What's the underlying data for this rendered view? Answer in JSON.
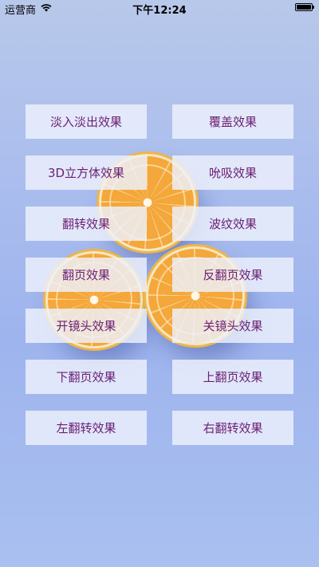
{
  "status_bar": {
    "carrier": "运营商",
    "wifi_icon": "wifi-icon",
    "time": "下午12:24",
    "battery_icon": "battery-icon",
    "battery_level": 1.0
  },
  "colors": {
    "button_text": "#6b1f73",
    "button_bg": "#eef2fc",
    "background": "#a9bcee"
  },
  "effects": [
    {
      "label": "淡入淡出效果"
    },
    {
      "label": "覆盖效果"
    },
    {
      "label": "3D立方体效果"
    },
    {
      "label": "吮吸效果"
    },
    {
      "label": "翻转效果"
    },
    {
      "label": "波纹效果"
    },
    {
      "label": "翻页效果"
    },
    {
      "label": "反翻页效果"
    },
    {
      "label": "开镜头效果"
    },
    {
      "label": "关镜头效果"
    },
    {
      "label": "下翻页效果"
    },
    {
      "label": "上翻页效果"
    },
    {
      "label": "左翻转效果"
    },
    {
      "label": "右翻转效果"
    }
  ]
}
